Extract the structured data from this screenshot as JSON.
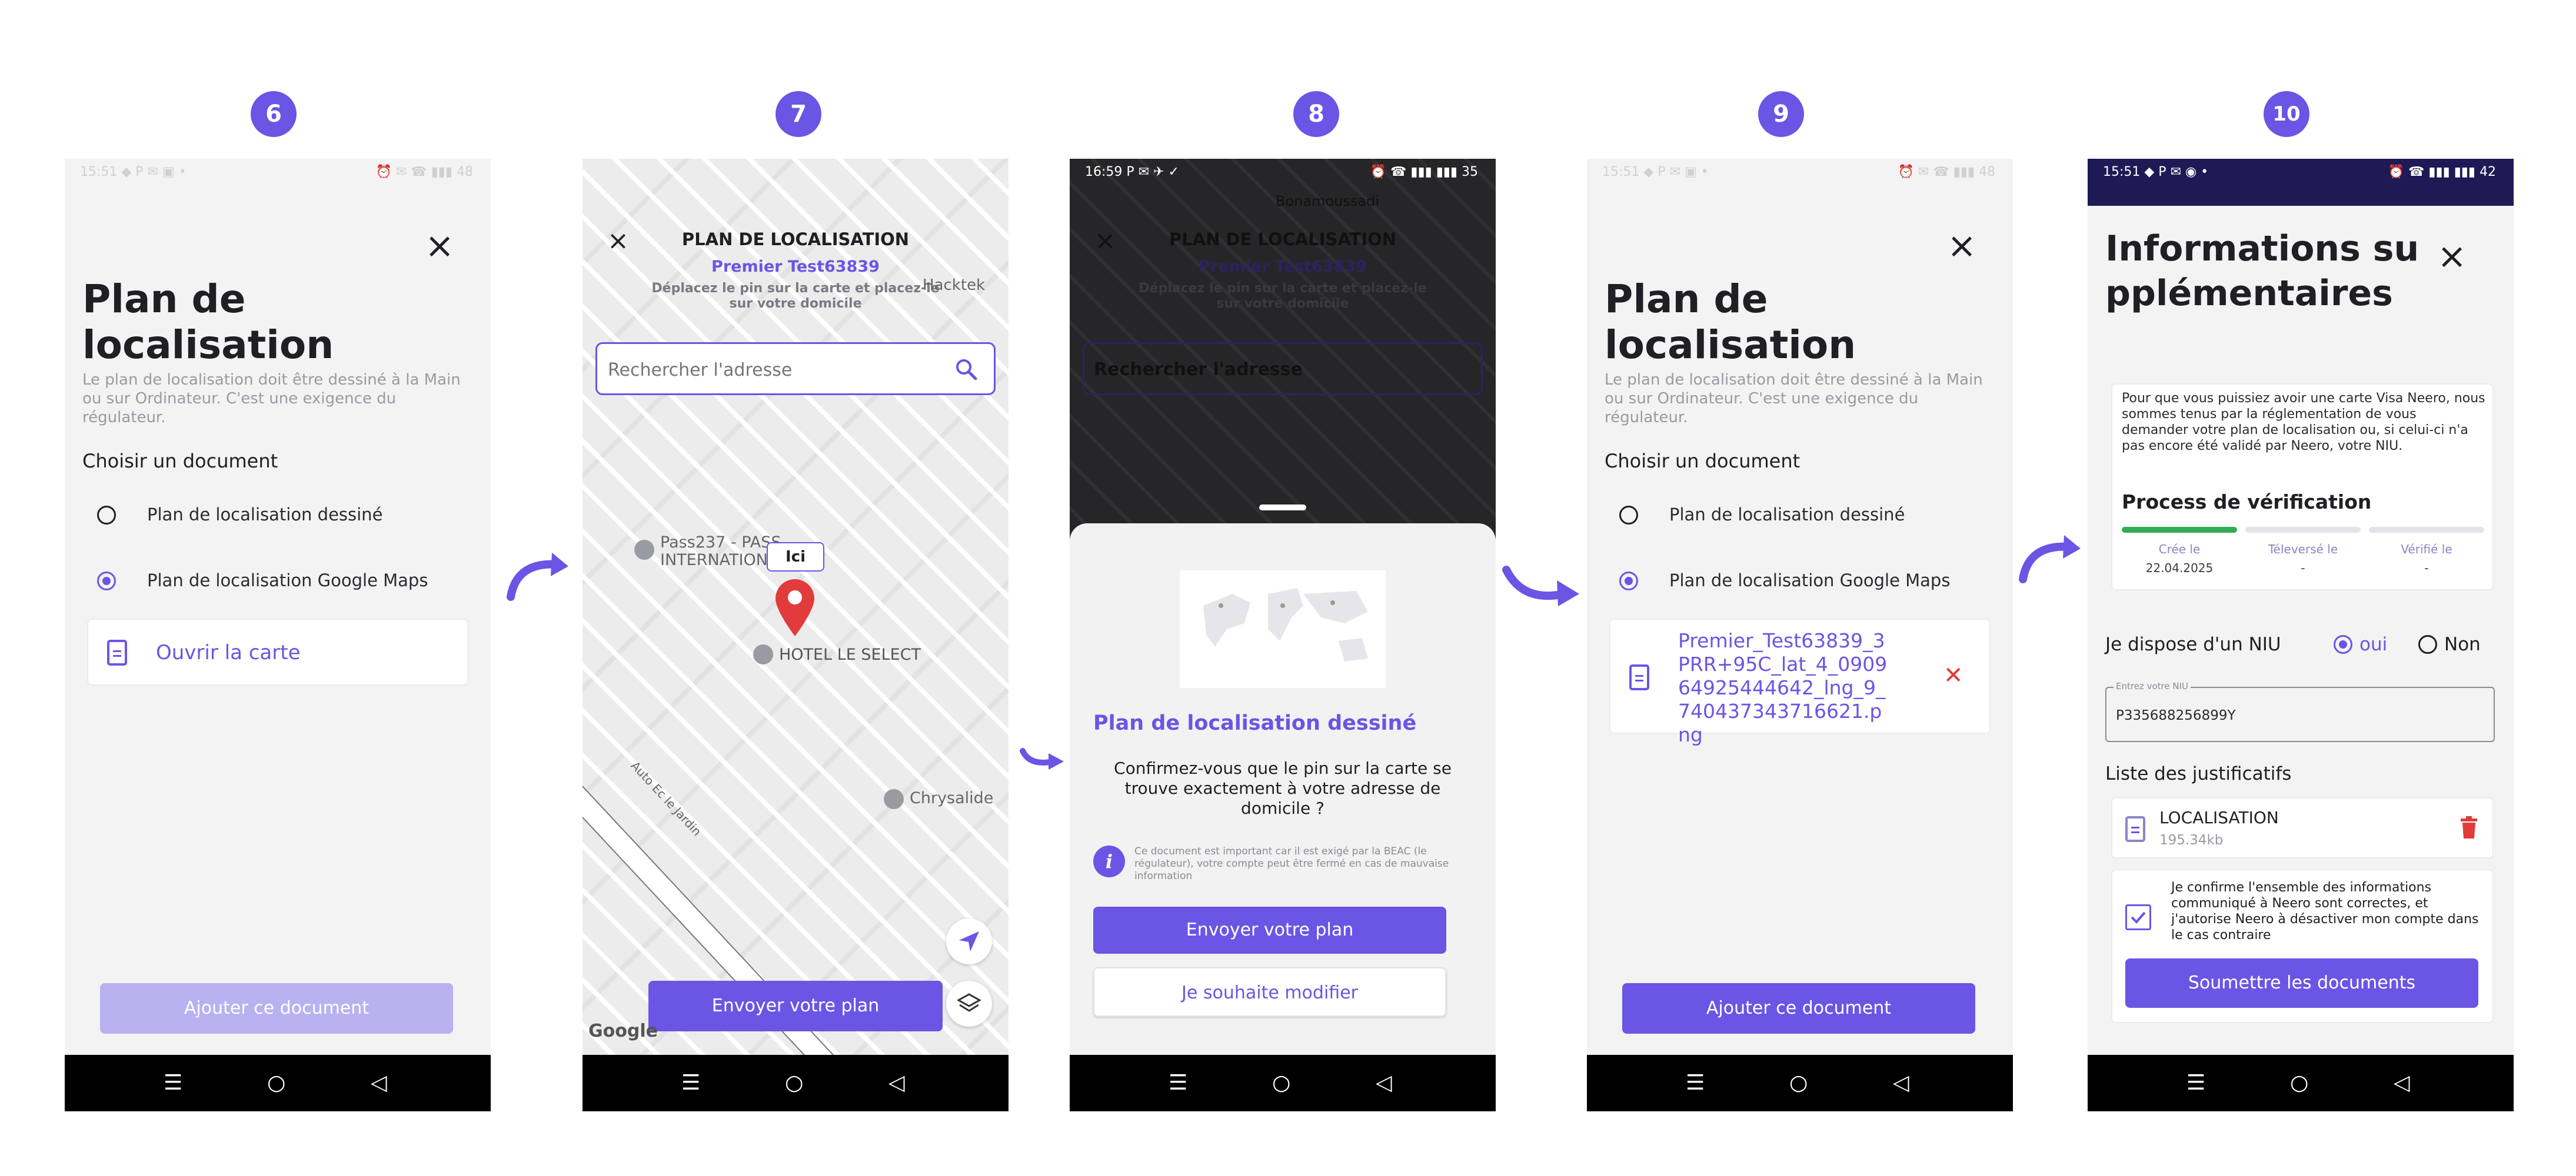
{
  "steps": [
    "6",
    "7",
    "8",
    "9",
    "10"
  ],
  "common": {
    "close_icon": "×",
    "nav_menu": "☰",
    "nav_home": "○",
    "nav_back": "◁"
  },
  "screen6": {
    "status_left": "15:51 ◆ P ✉ ▣ •",
    "status_right": "⏰ ✉ ☎ ▮▮▮ 48",
    "title": "Plan de localisation",
    "subtitle": "Le plan de localisation doit être dessiné à la Main ou sur Ordinateur. C'est une exigence du régulateur.",
    "choose_label": "Choisir un document",
    "option1": "Plan de localisation dessiné",
    "option2": "Plan de localisation Google Maps",
    "open_map": "Ouvrir la carte",
    "add_button": "Ajouter ce document"
  },
  "screen7": {
    "title": "PLAN DE LOCALISATION",
    "user": "Premier Test63839",
    "instruction": "Déplacez le pin sur la carte et placez-le sur votre domicile",
    "search_placeholder": "Rechercher l'adresse",
    "poi1": "Pass237 - PASS INTERNATION",
    "poi2": "HOTEL LE SELECT",
    "poi3": "Chrysalide",
    "poi4": "Hacktek",
    "road": "Auto Ec le Jardin",
    "pin_label": "Ici",
    "send_button": "Envoyer votre plan",
    "google": "Google"
  },
  "screen8": {
    "status_left": "16:59 P ✉ ✈ ✓",
    "status_right": "⏰ ☎ ▮▮▮ ▮▮▮ 35",
    "bg_title": "PLAN DE LOCALISATION",
    "bg_user": "Premier Test63839",
    "bg_instruction": "Déplacez le pin sur la carte et placez-le sur votre domicile",
    "bg_search": "Rechercher l'adresse",
    "bg_place1": "Bonamoussadi",
    "sheet_title": "Plan de localisation dessiné",
    "confirm_text": "Confirmez-vous que le pin sur la carte se trouve exactement à votre adresse de domicile ?",
    "info_text": "Ce document est important car il est exigé par la BEAC (le régulateur), votre compte peut être fermé en cas de mauvaise information",
    "send_button": "Envoyer votre plan",
    "modify_button": "Je souhaite modifier"
  },
  "screen9": {
    "status_left": "15:51 ◆ P ✉ ▣ •",
    "status_right": "⏰ ✉ ☎ ▮▮▮ 48",
    "title": "Plan de localisation",
    "subtitle": "Le plan de localisation doit être dessiné à la Main ou sur Ordinateur. C'est une exigence du régulateur.",
    "choose_label": "Choisir un document",
    "option1": "Plan de localisation dessiné",
    "option2": "Plan de localisation Google Maps",
    "file_name": "Premier_Test63839_3PRR+95C_lat_4_090964925444642_lng_9_740437343716621.png",
    "remove_icon": "✕",
    "add_button": "Ajouter ce document"
  },
  "screen10": {
    "status_left": "15:51 ◆ P ✉ ◉ •",
    "status_right": "⏰ ☎ ▮▮▮ ▮▮▮ 42",
    "title": "Informations supplémentaires",
    "notice": "Pour que vous puissiez avoir une carte Visa Neero, nous sommes tenus par la réglementation de vous demander votre plan de localisation ou, si celui-ci n'a pas encore été validé par Neero, votre NIU.",
    "process_title": "Process de vérification",
    "process": [
      {
        "label": "Crée le",
        "value": "22.04.2025"
      },
      {
        "label": "Téleversé le",
        "value": "-"
      },
      {
        "label": "Vérifié le",
        "value": "-"
      }
    ],
    "niu_question": "Je dispose d'un NIU",
    "yes": "oui",
    "no": "Non",
    "niu_field_label": "Entrez votre NIU",
    "niu_value": "P335688256899Y",
    "docs_title": "Liste des justificatifs",
    "doc_name": "LOCALISATION",
    "doc_size": "195.34kb",
    "checkbox_text": "Je confirme l'ensemble des informations communiqué à Neero sont correctes, et j'autorise Neero à désactiver mon compte dans le cas contraire",
    "submit_button": "Soumettre les documents"
  },
  "colors": {
    "accent": "#6a55e5",
    "accent_light": "#b9b1f0",
    "danger": "#e23b3b"
  }
}
